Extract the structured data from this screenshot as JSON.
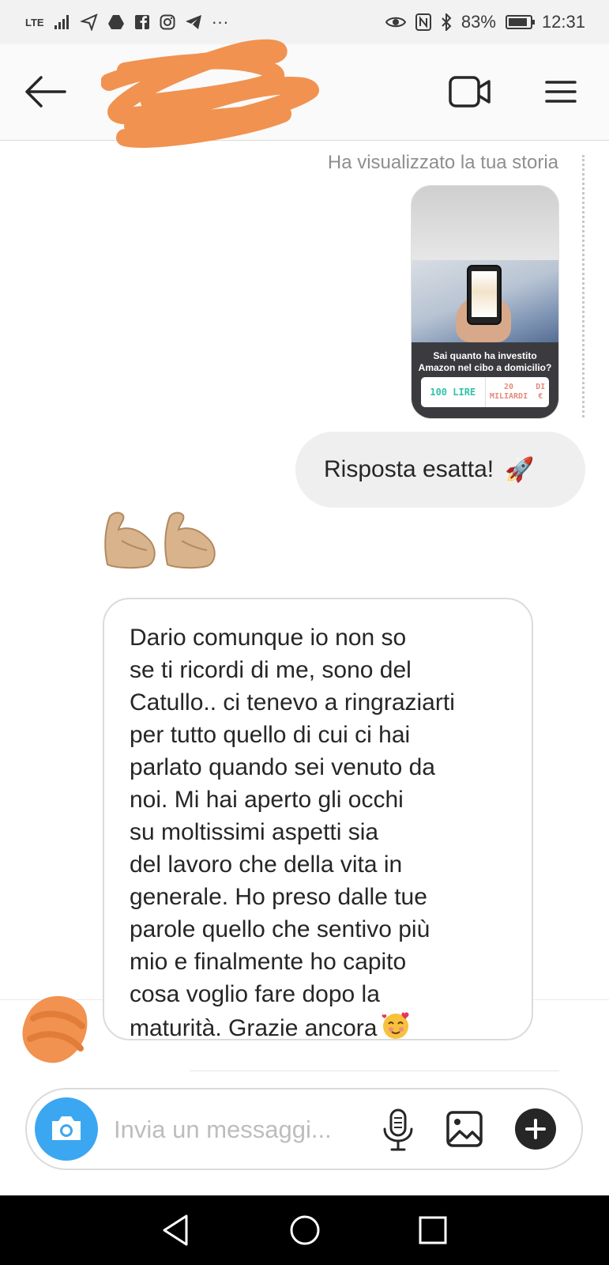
{
  "status_bar": {
    "network_label": "LTE",
    "battery_percent": "83%",
    "time": "12:31"
  },
  "header": {
    "back_icon": "arrow-left-icon",
    "video_icon": "video-camera-icon",
    "menu_icon": "hamburger-menu-icon"
  },
  "chat": {
    "story_caption": "Ha visualizzato la tua storia",
    "story_question_line1": "Sai quanto ha investito",
    "story_question_line2": "Amazon nel cibo a domicilio?",
    "story_answer_1": "100 LIRE",
    "story_answer_2_line1": "20 MILIARDI",
    "story_answer_2_line2": "DI €",
    "outgoing_message": "Risposta esatta!",
    "outgoing_emoji": "🚀",
    "incoming_lines": [
      "Dario comunque io non so",
      "se ti ricordi di me, sono del",
      "Catullo.. ci tenevo a ringraziarti",
      "per tutto quello di cui ci hai",
      "parlato quando sei venuto da",
      "noi. Mi hai aperto gli occhi",
      "su moltissimi aspetti sia",
      "del lavoro che della vita in",
      "generale. Ho preso dalle tue",
      "parole quello che sentivo più",
      "mio e finalmente ho capito",
      "cosa voglio fare dopo la",
      "maturità. Grazie ancora"
    ]
  },
  "composer": {
    "placeholder": "Invia un messaggi...",
    "camera_icon": "camera-icon",
    "mic_icon": "microphone-icon",
    "gallery_icon": "gallery-icon",
    "plus_icon": "plus-icon"
  },
  "colors": {
    "accent_blue": "#3ba7f1",
    "scribble_orange": "#f19250",
    "bubble_gray": "#efefef",
    "muscle_tan": "#d9b38c"
  }
}
